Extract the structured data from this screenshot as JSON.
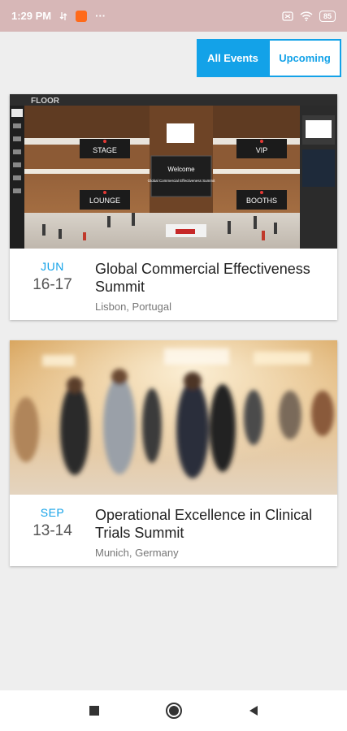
{
  "status": {
    "time": "1:29 PM",
    "dots": "···",
    "battery": "85"
  },
  "tabs": {
    "all_events": "All Events",
    "upcoming": "Upcoming"
  },
  "events": [
    {
      "month": "JUN",
      "days": "16-17",
      "title": "Global Commercial Effectiveness Summit",
      "location": "Lisbon, Portugal",
      "image": {
        "brand": "FLOOR",
        "labels": [
          "STAGE",
          "VIP",
          "LOUNGE",
          "BOOTHS"
        ],
        "welcome": "Welcome",
        "welcome_sub": "Global Commercial Effectiveness Summit"
      }
    },
    {
      "month": "SEP",
      "days": "13-14",
      "title": "Operational Excellence in Clinical Trials Summit",
      "location": "Munich, Germany"
    }
  ],
  "colors": {
    "accent": "#13a2e8",
    "status_bar": "#d7b7b7"
  }
}
